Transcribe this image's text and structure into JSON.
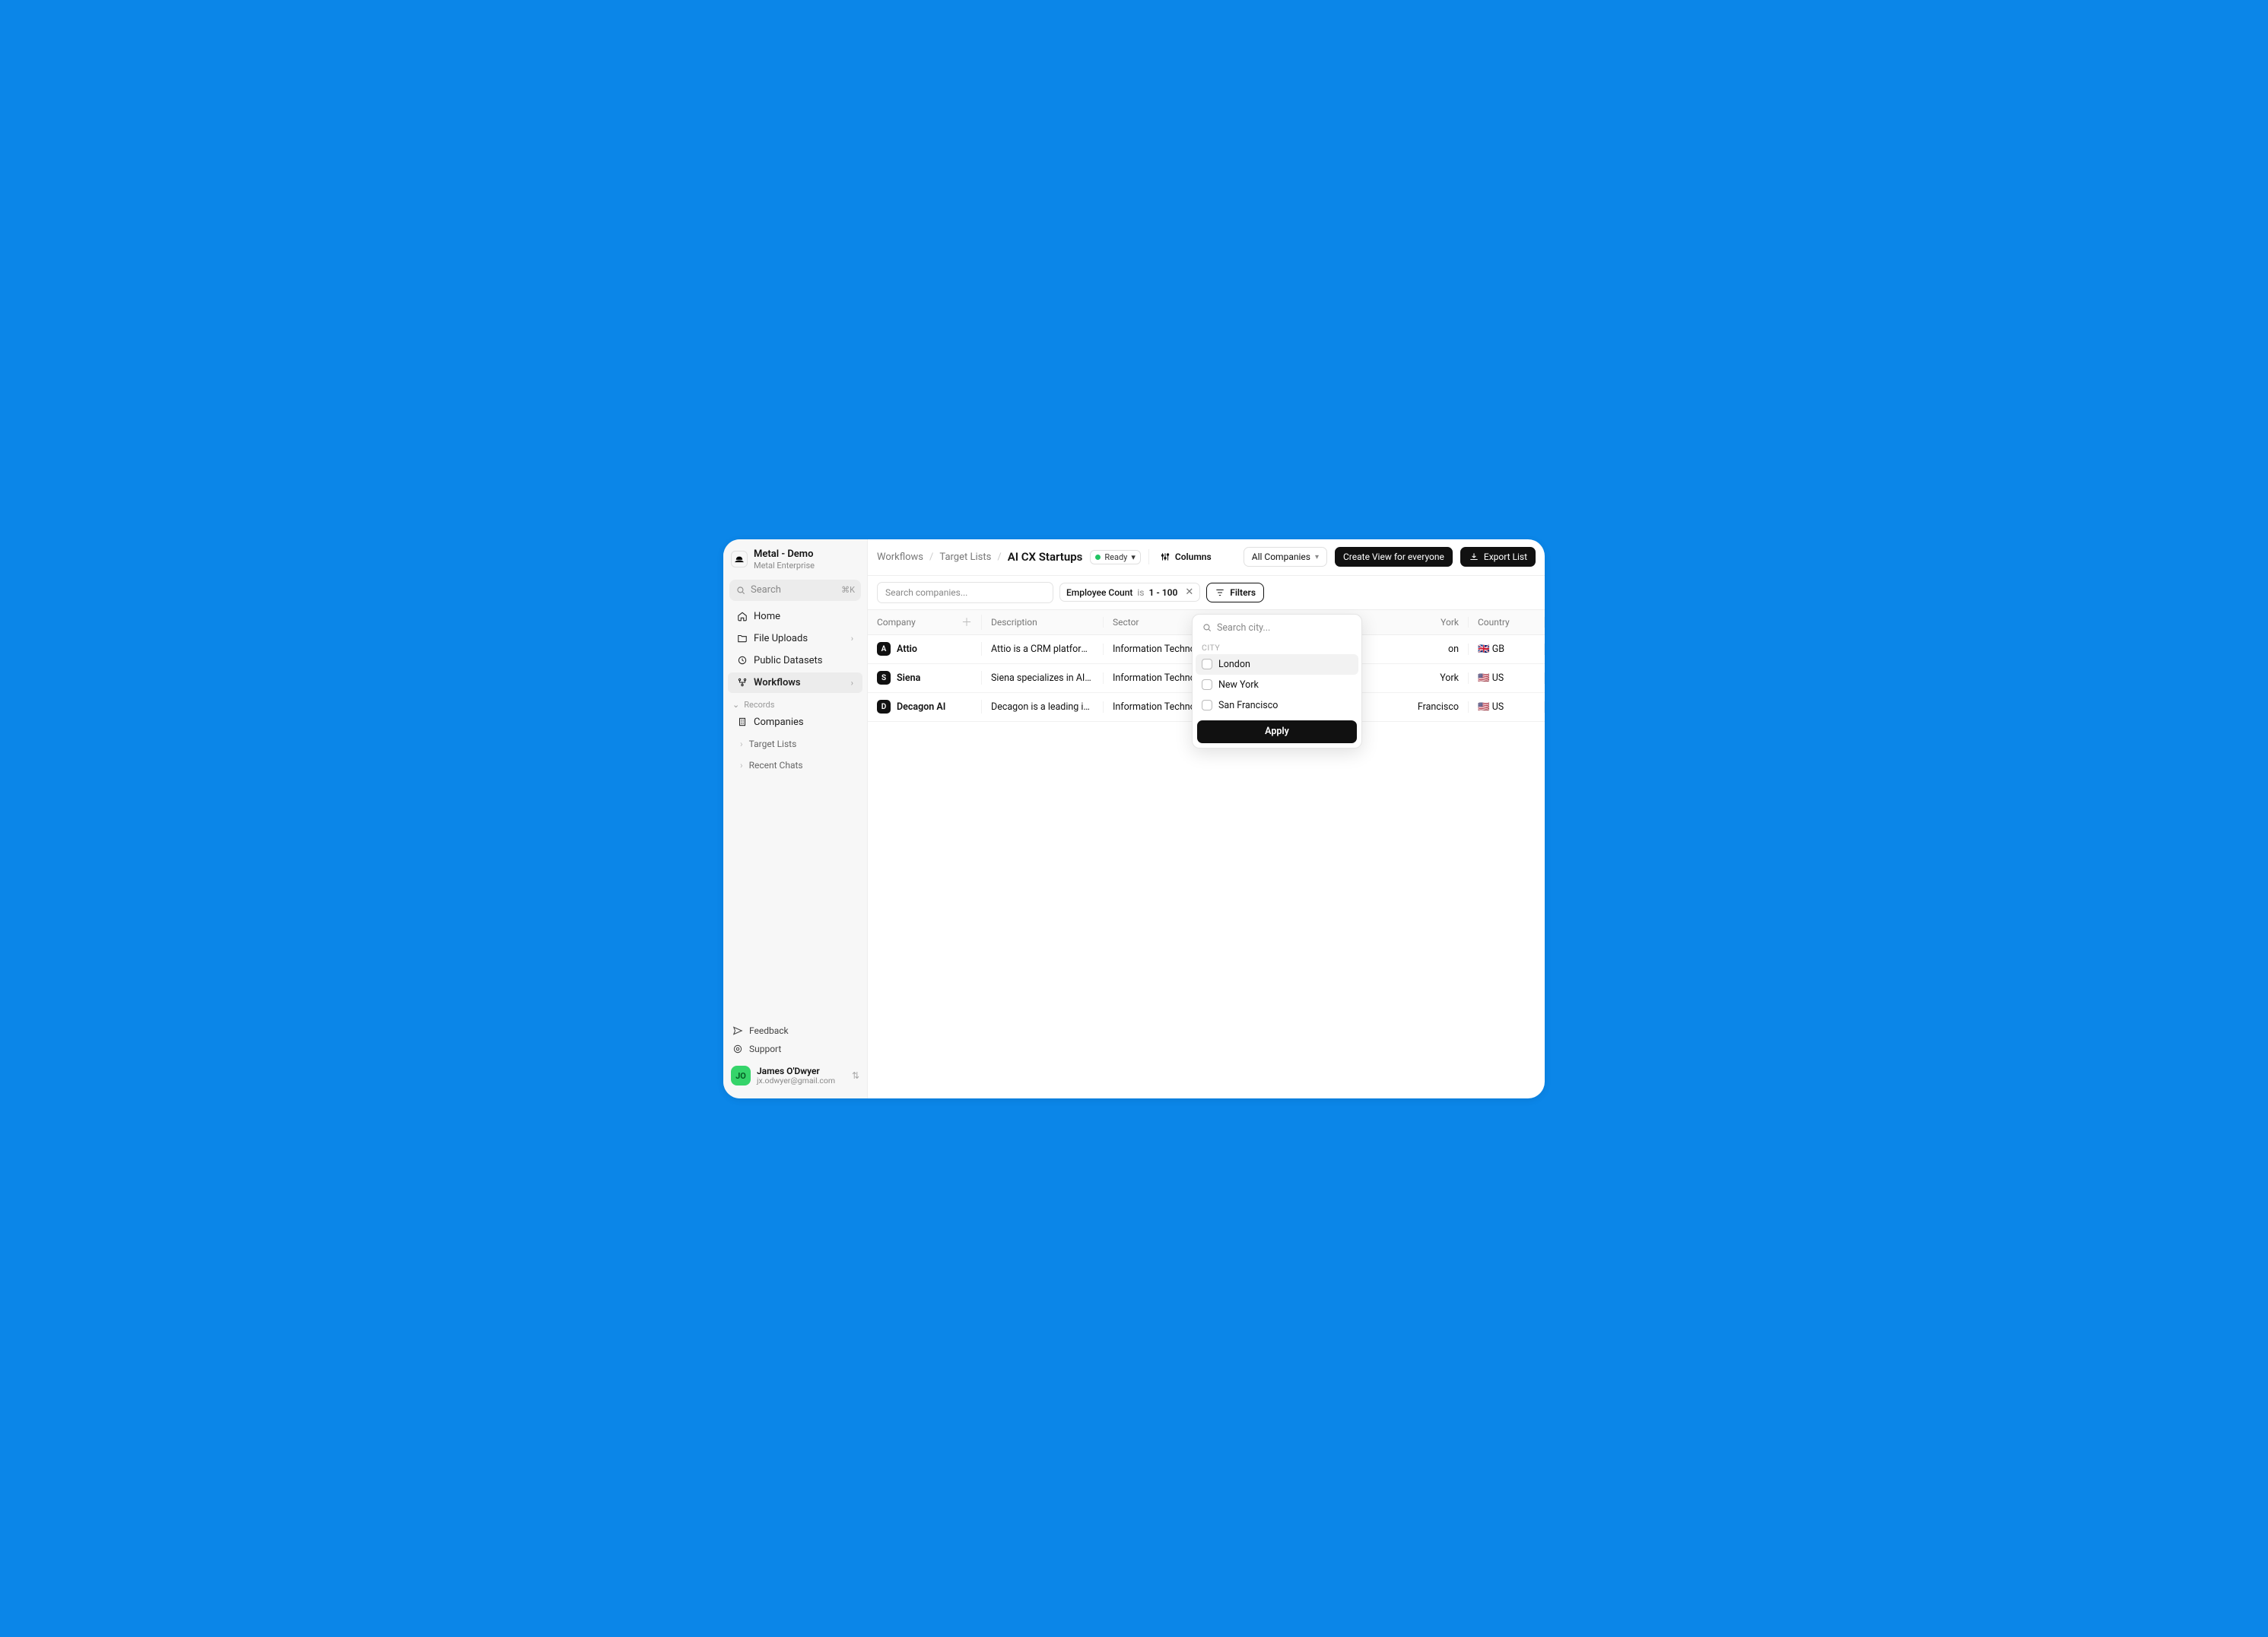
{
  "workspace": {
    "name": "Metal - Demo",
    "plan": "Metal Enterprise"
  },
  "sidebar": {
    "search_placeholder": "Search",
    "search_shortcut": "⌘K",
    "nav": {
      "home": "Home",
      "file_uploads": "File Uploads",
      "public_datasets": "Public Datasets",
      "workflows": "Workflows"
    },
    "records_label": "Records",
    "records": {
      "companies": "Companies"
    },
    "target_lists_label": "Target Lists",
    "recent_chats_label": "Recent Chats",
    "footer": {
      "feedback": "Feedback",
      "support": "Support"
    },
    "user": {
      "initials": "JO",
      "name": "James O'Dwyer",
      "email": "jx.odwyer@gmail.com"
    }
  },
  "topbar": {
    "crumbs": [
      "Workflows",
      "Target Lists",
      "AI CX Startups"
    ],
    "status": "Ready",
    "columns_label": "Columns",
    "companies_dropdown": "All Companies",
    "create_view": "Create View for everyone",
    "export": "Export List"
  },
  "filterbar": {
    "search_placeholder": "Search companies...",
    "chip_field": "Employee Count",
    "chip_op": "is",
    "chip_value": "1 - 100",
    "filters_label": "Filters"
  },
  "columns": [
    "Company",
    "Description",
    "Sector",
    "",
    "",
    "Country",
    ""
  ],
  "hidden_city_header_fragment": "York",
  "rows": [
    {
      "company": "Attio",
      "description": "Attio is a CRM platform t…",
      "sector": "Information Technology",
      "city": "on",
      "country": "GB",
      "flag": "🇬🇧"
    },
    {
      "company": "Siena",
      "description": "Siena specializes in AI-d…",
      "sector": "Information Technology",
      "city": "York",
      "country": "US",
      "flag": "🇺🇸"
    },
    {
      "company": "Decagon AI",
      "description": "Decagon is a leading inn…",
      "sector": "Information Technology",
      "city": "Francisco",
      "country": "US",
      "flag": "🇺🇸"
    }
  ],
  "popover": {
    "search_placeholder": "Search city...",
    "section_label": "CITY",
    "options": [
      "London",
      "New York",
      "San Francisco"
    ],
    "apply": "Apply"
  }
}
